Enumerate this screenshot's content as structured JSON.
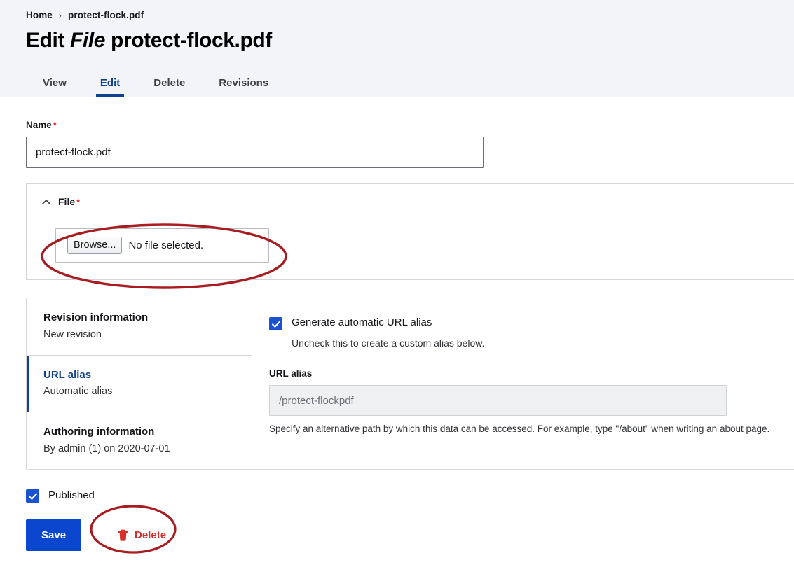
{
  "breadcrumb": {
    "home_label": "Home",
    "separator": "›",
    "current_label": "protect-flock.pdf"
  },
  "page_title": {
    "prefix": "Edit",
    "entity_type": "File",
    "entity_name": "protect-flock.pdf"
  },
  "tabs": [
    {
      "label": "View",
      "active": false
    },
    {
      "label": "Edit",
      "active": true
    },
    {
      "label": "Delete",
      "active": false
    },
    {
      "label": "Revisions",
      "active": false
    }
  ],
  "name_field": {
    "label": "Name",
    "required_marker": "*",
    "value": "protect-flock.pdf"
  },
  "file_fieldset": {
    "legend": "File",
    "required_marker": "*",
    "collapse_icon": "chevron-up-icon",
    "browse_button_label": "Browse...",
    "file_status": "No file selected."
  },
  "vertical_tabs": [
    {
      "title": "Revision information",
      "summary": "New revision",
      "active": false
    },
    {
      "title": "URL alias",
      "summary": "Automatic alias",
      "active": true
    },
    {
      "title": "Authoring information",
      "summary": "By admin (1) on 2020-07-01",
      "active": false
    }
  ],
  "url_alias_panel": {
    "generate_checkbox_label": "Generate automatic URL alias",
    "generate_checkbox_checked": true,
    "generate_description": "Uncheck this to create a custom alias below.",
    "alias_label": "URL alias",
    "alias_value": "/protect-flockpdf",
    "alias_help": "Specify an alternative path by which this data can be accessed. For example, type \"/about\" when writing an about page."
  },
  "published": {
    "label": "Published",
    "checked": true
  },
  "actions": {
    "save_label": "Save",
    "delete_label": "Delete",
    "delete_icon": "trash-icon"
  },
  "colors": {
    "header_background": "#f3f4f9",
    "accent_blue": "#10418f",
    "primary_button_blue": "#0b46cf",
    "checkbox_blue": "#1a52d0",
    "delete_red": "#d5302b",
    "required_red": "#d72222",
    "annotation_red": "#a71d21"
  },
  "annotations": [
    {
      "name": "file-input-highlight",
      "shape": "ellipse"
    },
    {
      "name": "delete-link-highlight",
      "shape": "ellipse"
    }
  ]
}
